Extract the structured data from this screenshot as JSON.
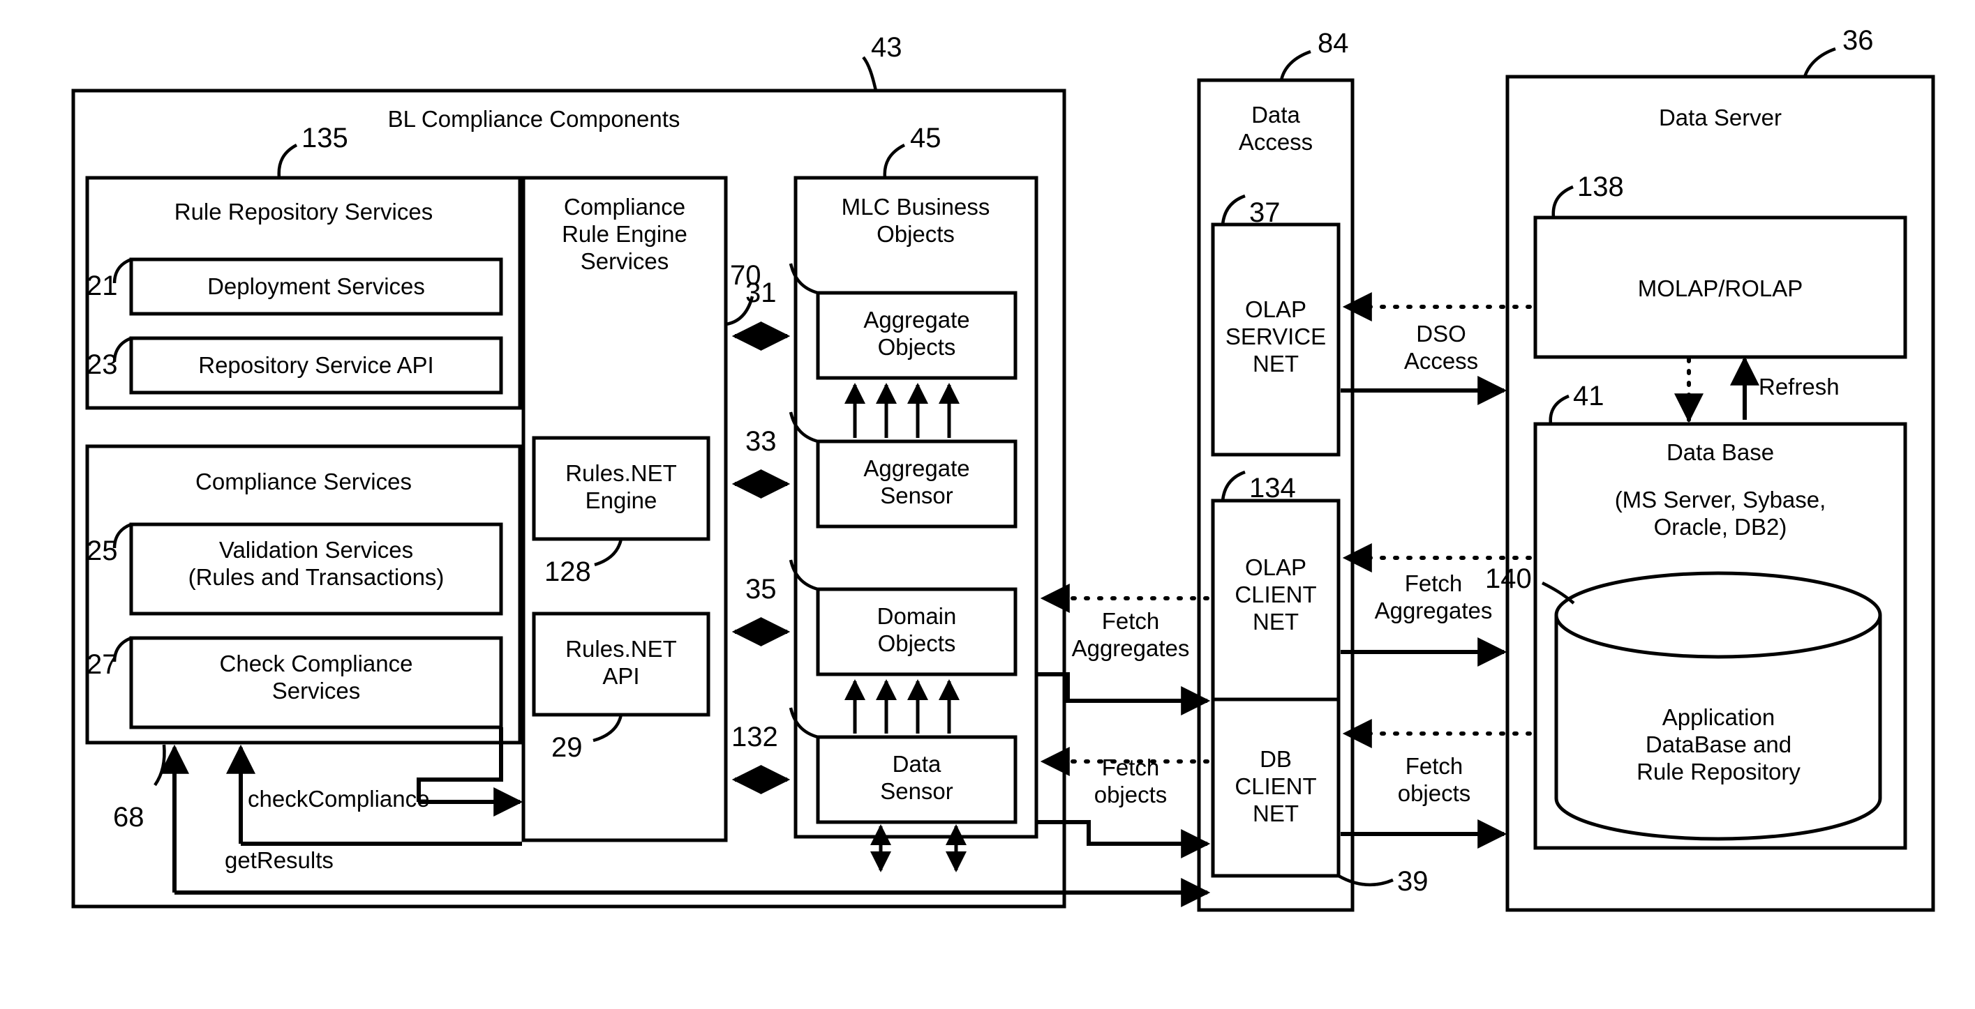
{
  "figure": {
    "kind": "patent-block-diagram",
    "stroke_color": "#000000",
    "background": "#ffffff"
  },
  "panels": {
    "bl_compliance": {
      "title": "BL Compliance Components",
      "ref": "43",
      "rule_repository": {
        "title": "Rule Repository Services",
        "ref": "135",
        "items": [
          {
            "label": "Deployment Services",
            "ref": "21"
          },
          {
            "label": "Repository Service API",
            "ref": "23"
          }
        ]
      },
      "compliance_services": {
        "title": "Compliance Services",
        "items": [
          {
            "label": "Validation Services\n(Rules and Transactions)",
            "ref": "25"
          },
          {
            "label": "Check Compliance\nServices",
            "ref": "27"
          }
        ]
      },
      "rule_engine": {
        "title": "Compliance\nRule Engine\nServices",
        "ref": "70",
        "items": [
          {
            "label": "Rules.NET\nEngine",
            "ref": "128"
          },
          {
            "label": "Rules.NET\nAPI",
            "ref": "29"
          }
        ]
      },
      "mlc_business_objects": {
        "title": "MLC Business\nObjects",
        "ref": "45",
        "items": [
          {
            "label": "Aggregate\nObjects",
            "ref": "31"
          },
          {
            "label": "Aggregate\nSensor",
            "ref": "33"
          },
          {
            "label": "Domain\nObjects",
            "ref": "35"
          },
          {
            "label": "Data\nSensor",
            "ref": "132"
          }
        ]
      },
      "callout_ref": "68",
      "calls": [
        {
          "label": "checkCompliance"
        },
        {
          "label": "getResults"
        }
      ]
    },
    "data_access": {
      "title": "Data\nAccess",
      "ref": "84",
      "bottom_ref": "39",
      "items": [
        {
          "label": "OLAP\nSERVICE\nNET",
          "ref": "37"
        },
        {
          "label": "OLAP\nCLIENT\nNET",
          "ref": "134"
        },
        {
          "label": "DB\nCLIENT\nNET",
          "ref": ""
        }
      ]
    },
    "data_server": {
      "title": "Data Server",
      "ref": "36",
      "olap_box": {
        "label": "MOLAP/ROLAP",
        "ref": "138"
      },
      "database": {
        "title": "Data Base",
        "subtitle": "(MS Server, Sybase,\nOracle, DB2)",
        "ref": "41",
        "cylinder": {
          "label": "Application\nDataBase and\nRule Repository",
          "ref": "140"
        }
      },
      "refresh_label": "Refresh"
    }
  },
  "flow_labels": {
    "dso_access": "DSO\nAccess",
    "fetch_aggregates_left": "Fetch\nAggregates",
    "fetch_objects_left": "Fetch\nobjects",
    "fetch_aggregates_right": "Fetch\nAggregates",
    "fetch_objects_right": "Fetch\nobjects"
  }
}
